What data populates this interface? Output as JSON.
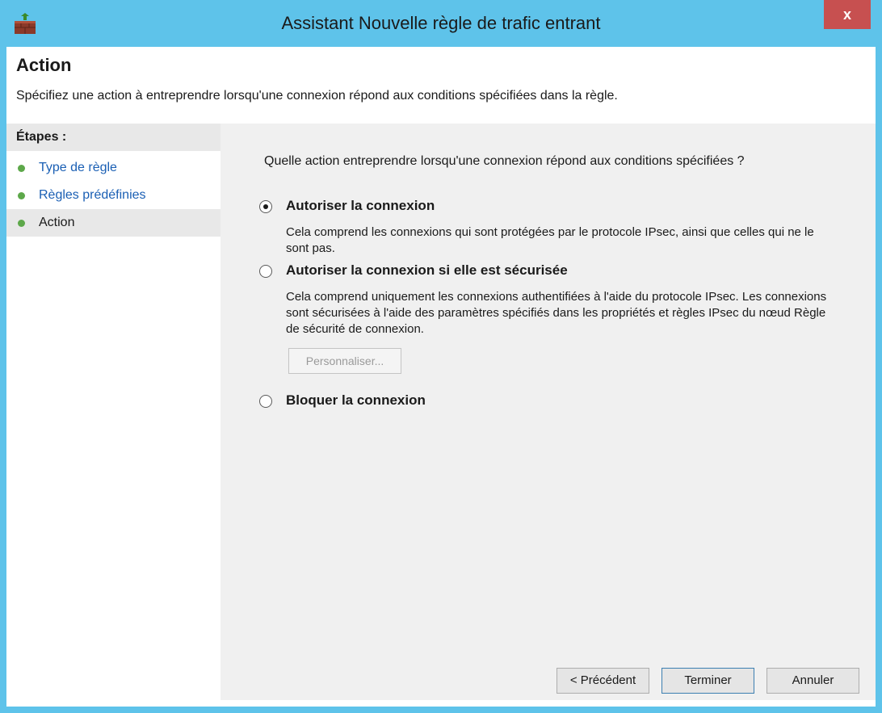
{
  "window": {
    "title": "Assistant Nouvelle règle de trafic entrant",
    "close_label": "x"
  },
  "header": {
    "title": "Action",
    "description": "Spécifiez une action à entreprendre lorsqu'une connexion répond aux conditions spécifiées dans la règle."
  },
  "steps": {
    "heading": "Étapes :",
    "items": [
      {
        "label": "Type de règle"
      },
      {
        "label": "Règles prédéfinies"
      },
      {
        "label": "Action"
      }
    ]
  },
  "main": {
    "question": "Quelle action entreprendre lorsqu'une connexion répond aux conditions spécifiées ?",
    "options": [
      {
        "label": "Autoriser la connexion",
        "checked": true,
        "description": "Cela comprend les connexions qui sont protégées par le protocole IPsec, ainsi que celles qui ne le sont pas."
      },
      {
        "label": "Autoriser la connexion si elle est sécurisée",
        "checked": false,
        "description": "Cela comprend uniquement les connexions authentifiées à l'aide du protocole IPsec. Les connexions sont sécurisées à l'aide des paramètres spécifiés dans les propriétés et règles IPsec du nœud Règle de sécurité de connexion."
      },
      {
        "label": "Bloquer la connexion",
        "checked": false
      }
    ],
    "customize_label": "Personnaliser..."
  },
  "footer": {
    "back_label": "< Précédent",
    "finish_label": "Terminer",
    "cancel_label": "Annuler"
  },
  "colors": {
    "titlebar": "#5ec3ea",
    "close": "#c75050",
    "step_dot": "#5da84a",
    "link": "#1a5fb4"
  },
  "icons": {
    "app": "firewall-icon",
    "close": "close-icon"
  }
}
